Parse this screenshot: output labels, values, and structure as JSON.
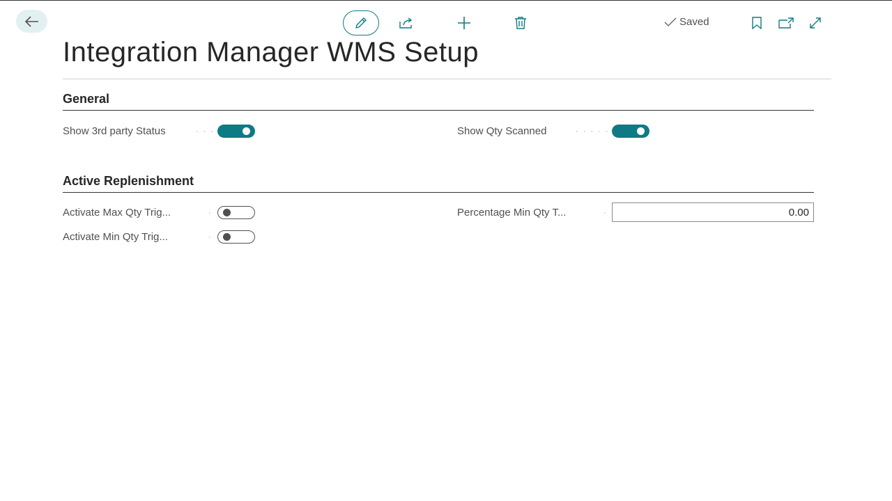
{
  "header": {
    "status": "Saved",
    "title": "Integration Manager WMS Setup"
  },
  "toolbar": {
    "icons": [
      "back-arrow-icon",
      "pencil-icon",
      "share-icon",
      "plus-icon",
      "trash-icon",
      "checkmark-icon",
      "bookmark-icon",
      "open-in-new-window-icon",
      "expand-icon"
    ]
  },
  "sections": {
    "general": {
      "title": "General",
      "show_3rd_party_status": {
        "label": "Show 3rd party Status",
        "value": true
      },
      "show_qty_scanned": {
        "label": "Show Qty Scanned",
        "value": true
      }
    },
    "active_replenishment": {
      "title": "Active Replenishment",
      "activate_max_qty": {
        "label": "Activate Max Qty Trig...",
        "value": false
      },
      "activate_min_qty": {
        "label": "Activate Min Qty Trig...",
        "value": false
      },
      "percentage_min_qty": {
        "label": "Percentage Min Qty T...",
        "value": "0.00"
      }
    }
  },
  "colors": {
    "accent": "#0e7a84",
    "back_button_bg": "#e3f0f1"
  }
}
